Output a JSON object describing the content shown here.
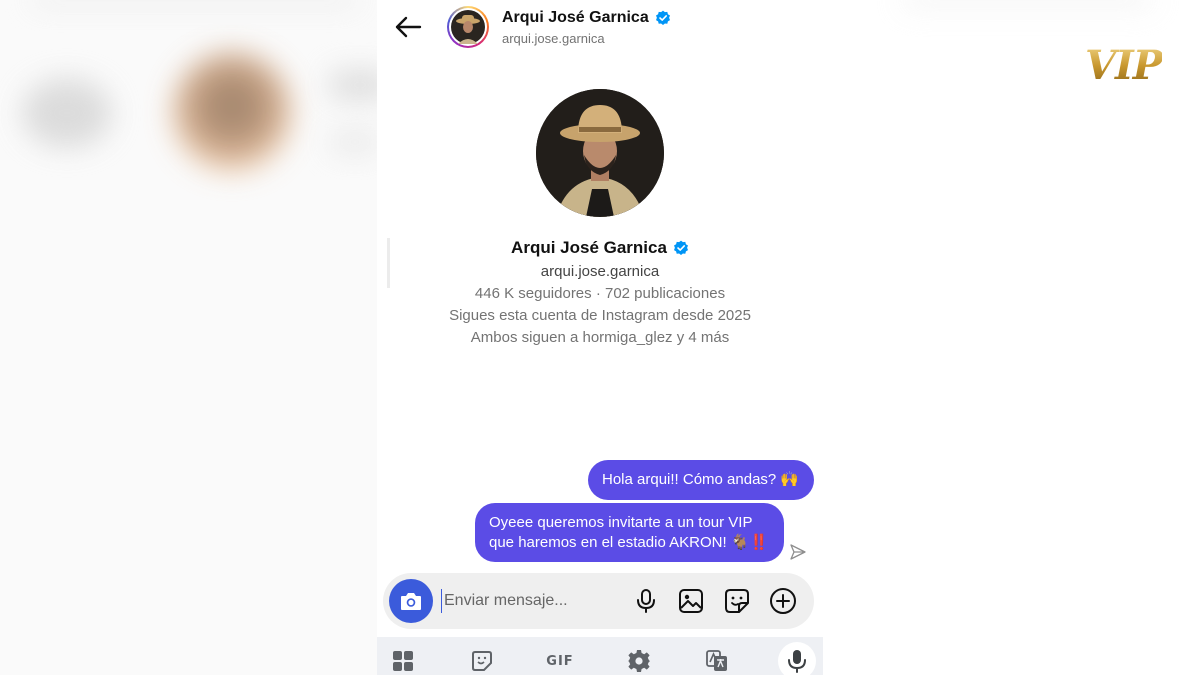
{
  "header": {
    "display_name": "Arqui José Garnica",
    "username": "arqui.jose.garnica"
  },
  "profile": {
    "display_name": "Arqui José Garnica",
    "username": "arqui.jose.garnica",
    "stats": "446 K seguidores · 702 publicaciones",
    "following_since": "Sigues esta cuenta de Instagram desde 2025",
    "mutuals": "Ambos siguen a hormiga_glez y 4 más"
  },
  "messages": [
    {
      "text": "Hola arqui!! Cómo andas? 🙌",
      "from": "me"
    },
    {
      "line1": "Oyeee queremos invitarte a un tour VIP",
      "line2": "que haremos en el estadio AKRON! 🐐‼️",
      "from": "me"
    }
  ],
  "composer": {
    "placeholder": "Enviar mensaje...",
    "value": ""
  },
  "keyboard": {
    "gif_label": "GIF"
  },
  "watermark": "VIP",
  "colors": {
    "bubble": "#5b4ce6",
    "camera_button": "#3b5bdb",
    "verified": "#0095f6",
    "composer_bg": "#efefef"
  },
  "icons": [
    "back-arrow-icon",
    "verified-icon",
    "send-status-icon",
    "camera-icon",
    "microphone-icon",
    "gallery-icon",
    "sticker-icon",
    "plus-icon",
    "apps-grid-icon",
    "keyboard-sticker-icon",
    "settings-icon",
    "translate-icon",
    "voice-input-icon"
  ]
}
